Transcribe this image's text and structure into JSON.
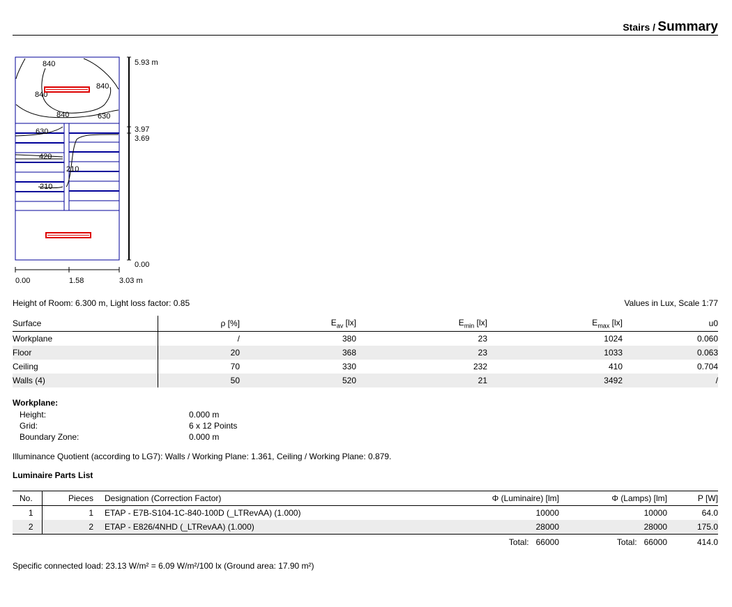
{
  "header": {
    "room": "Stairs /",
    "page": "Summary"
  },
  "plan": {
    "y_labels": [
      "5.93 m",
      "3.97",
      "3.69",
      "0.00"
    ],
    "x_labels": [
      "0.00",
      "1.58",
      "3.03 m"
    ],
    "contour_labels": [
      "840",
      "840",
      "840",
      "840",
      "630",
      "630",
      "420",
      "210",
      "210"
    ]
  },
  "info": {
    "room_line": "Height of Room: 6.300 m, Light loss factor: 0.85",
    "values_line": "Values in Lux, Scale 1:77"
  },
  "surfaces": {
    "headers": {
      "surface": "Surface",
      "rho": "ρ [%]",
      "eav_main": "E",
      "eav_sub": "av",
      "eav_unit": " [lx]",
      "emin_main": "E",
      "emin_sub": "min",
      "emin_unit": " [lx]",
      "emax_main": "E",
      "emax_sub": "max",
      "emax_unit": " [lx]",
      "u0": "u0"
    },
    "rows": [
      {
        "surface": "Workplane",
        "rho": "/",
        "eav": "380",
        "emin": "23",
        "emax": "1024",
        "u0": "0.060"
      },
      {
        "surface": "Floor",
        "rho": "20",
        "eav": "368",
        "emin": "23",
        "emax": "1033",
        "u0": "0.063"
      },
      {
        "surface": "Ceiling",
        "rho": "70",
        "eav": "330",
        "emin": "232",
        "emax": "410",
        "u0": "0.704"
      },
      {
        "surface": "Walls (4)",
        "rho": "50",
        "eav": "520",
        "emin": "21",
        "emax": "3492",
        "u0": "/"
      }
    ]
  },
  "workplane": {
    "title": "Workplane:",
    "items": [
      {
        "label": "Height:",
        "value": "0.000 m"
      },
      {
        "label": "Grid:",
        "value": "6 x 12 Points"
      },
      {
        "label": "Boundary Zone:",
        "value": "0.000 m"
      }
    ]
  },
  "quotient": "Illuminance Quotient (according to LG7): Walls / Working Plane: 1.361, Ceiling / Working Plane: 0.879.",
  "parts": {
    "title": "Luminaire Parts List",
    "headers": {
      "no": "No.",
      "pieces": "Pieces",
      "designation": "Designation (Correction Factor)",
      "phi_lum": "Φ (Luminaire) [lm]",
      "phi_lamps": "Φ (Lamps) [lm]",
      "power": "P [W]"
    },
    "rows": [
      {
        "no": "1",
        "pieces": "1",
        "designation": "ETAP - E7B-S104-1C-840-100D (_LTRevAA) (1.000)",
        "phi_lum": "10000",
        "phi_lamps": "10000",
        "power": "64.0"
      },
      {
        "no": "2",
        "pieces": "2",
        "designation": "ETAP - E826/4NHD (_LTRevAA) (1.000)",
        "phi_lum": "28000",
        "phi_lamps": "28000",
        "power": "175.0"
      }
    ],
    "total_label": "Total:",
    "total_lum": "66000",
    "total_lamps": "66000",
    "total_power": "414.0"
  },
  "specific_load": "Specific connected load: 23.13 W/m² = 6.09 W/m²/100 lx (Ground area: 17.90 m²)",
  "colors": {
    "plan_lines": "#000099",
    "luminaire": "#dd0000",
    "row_shade": "#ececec"
  }
}
